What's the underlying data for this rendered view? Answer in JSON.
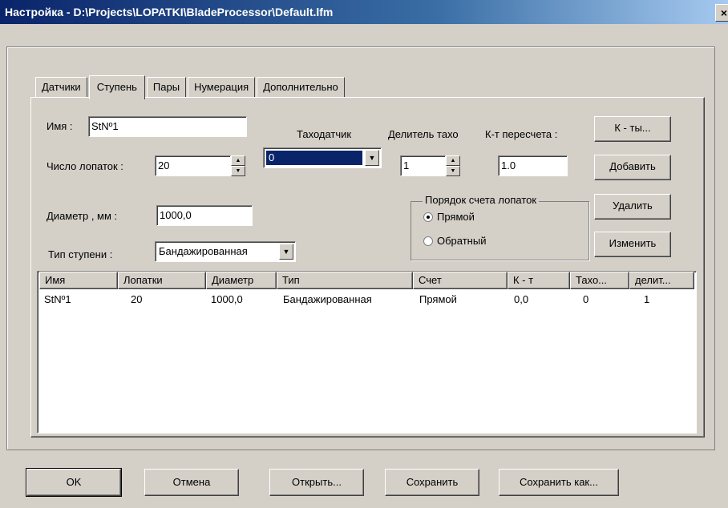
{
  "window": {
    "title": "Настройка - D:\\Projects\\LOPATKI\\BladeProcessor\\Default.lfm",
    "close_label": "×"
  },
  "tabs": [
    {
      "label": "Датчики",
      "active": false
    },
    {
      "label": "Ступень",
      "active": true
    },
    {
      "label": "Пары",
      "active": false
    },
    {
      "label": "Нумерация",
      "active": false
    },
    {
      "label": "Дополнительно",
      "active": false
    }
  ],
  "form": {
    "name_label": "Имя :",
    "name_value": "StNº1",
    "blades_label": "Число лопаток :",
    "blades_value": "20",
    "diameter_label": "Диаметр , мм :",
    "diameter_value": "1000,0",
    "stage_type_label": "Тип ступени :",
    "stage_type_value": "Бандажированная",
    "tacho_label": "Таходатчик",
    "tacho_value": "0",
    "divider_label": "Делитель тахо",
    "divider_value": "1",
    "coef_label": "К-т пересчета :",
    "coef_value": "1.0"
  },
  "order_group": {
    "title": "Порядок счета лопаток",
    "options": [
      {
        "label": "Прямой",
        "selected": true
      },
      {
        "label": "Обратный",
        "selected": false
      }
    ]
  },
  "side_buttons": {
    "coefs": "К - ты...",
    "add": "Добавить",
    "delete": "Удалить",
    "edit": "Изменить"
  },
  "table": {
    "columns": [
      "Имя",
      "Лопатки",
      "Диаметр",
      "Тип",
      "Счет",
      "К - т",
      "Тахо...",
      "делит..."
    ],
    "rows": [
      [
        "StNº1",
        "20",
        "1000,0",
        "Бандажированная",
        "Прямой",
        "0,0",
        "0",
        "1"
      ]
    ]
  },
  "bottom_buttons": {
    "ok": "OK",
    "cancel": "Отмена",
    "open": "Открыть...",
    "save": "Сохранить",
    "save_as": "Сохранить как..."
  },
  "colors": {
    "title_gradient_start": "#0a246a",
    "title_gradient_end": "#a6caf0",
    "face": "#d4d0c8",
    "selection": "#0a246a"
  }
}
